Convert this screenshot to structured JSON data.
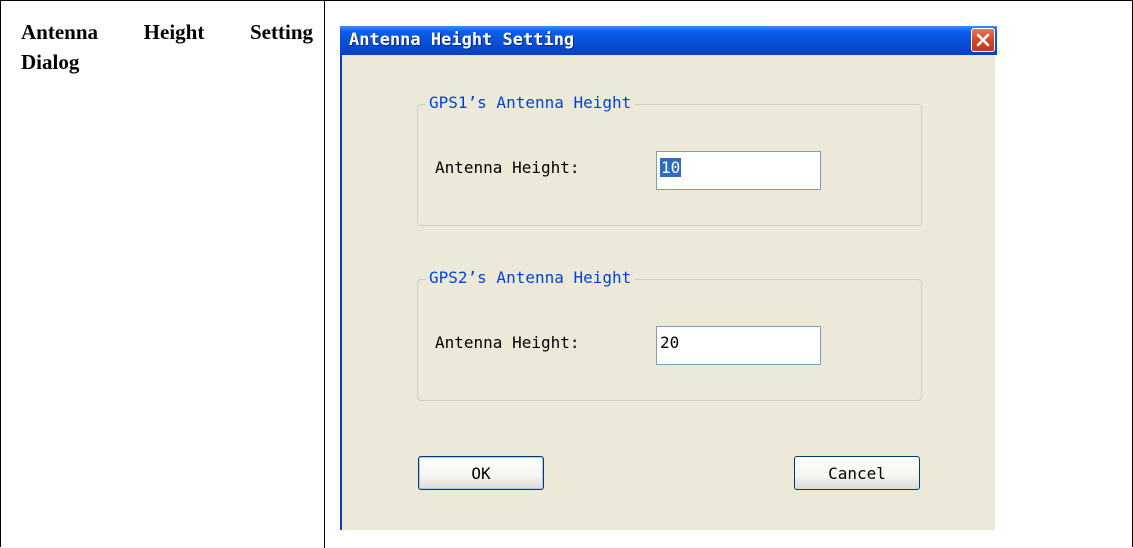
{
  "document": {
    "caption_line1": "Antenna Height Setting",
    "caption_line2": "Dialog"
  },
  "dialog": {
    "title": "Antenna Height Setting",
    "close_icon": "close-x-icon",
    "groups": [
      {
        "title": "GPS1’s Antenna Height",
        "label": "Antenna Height:",
        "value": "10",
        "selected": true
      },
      {
        "title": "GPS2’s Antenna Height",
        "label": "Antenna Height:",
        "value": "20",
        "selected": false
      }
    ],
    "ok_label": "OK",
    "cancel_label": "Cancel"
  },
  "colors": {
    "titlebar": "#0a4fd6",
    "dialog_bg": "#ece9d8",
    "group_title": "#0046d5",
    "selection": "#316ac5",
    "close_button": "#d6462a"
  }
}
